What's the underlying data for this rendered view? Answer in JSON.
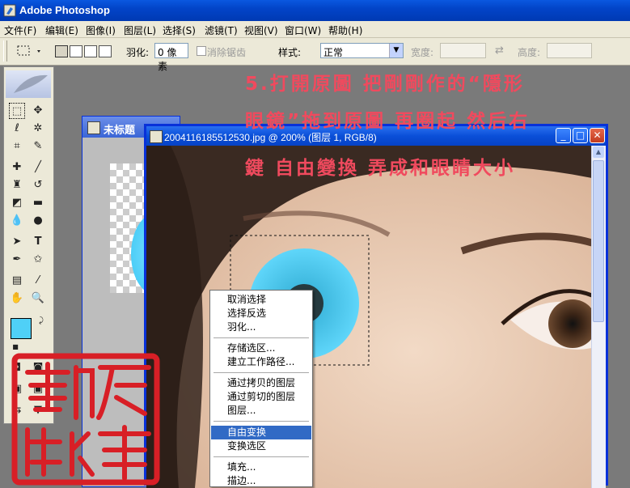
{
  "app": {
    "title": "Adobe Photoshop"
  },
  "menubar": {
    "items": [
      "文件(F)",
      "编辑(E)",
      "图像(I)",
      "图层(L)",
      "选择(S)",
      "滤镜(T)",
      "视图(V)",
      "窗口(W)",
      "帮助(H)"
    ]
  },
  "options": {
    "feather_label": "羽化:",
    "feather_value": "0 像素",
    "antialias_label": "消除锯齿",
    "style_label": "样式:",
    "style_value": "正常",
    "width_label": "宽度:",
    "height_label": "高度:"
  },
  "doc_back": {
    "title": "未标题"
  },
  "doc_front": {
    "title": "2004116185512530.jpg @ 200% (图层 1, RGB/8)"
  },
  "colors": {
    "foreground": "#4fd0f7",
    "background": "#ffffff",
    "annotation": "#f04a5e",
    "menu_highlight": "#316ac5"
  },
  "annotation": {
    "line1": "5.打開原圖 把剛剛作的“隱形",
    "line2": "眼鏡”拖到原圖 再圈起 然后右",
    "line3": "鍵 自由變換 弄成和眼睛大小"
  },
  "context_menu": {
    "items": [
      "取消选择",
      "选择反选",
      "羽化...",
      "存储选区...",
      "建立工作路径...",
      "通过拷贝的图层",
      "通过剪切的图层",
      "图层...",
      "自由变换",
      "变换选区",
      "填充...",
      "描边..."
    ],
    "selected": "自由变换"
  },
  "seal": {
    "text": "彭虎軒 作"
  },
  "icons": [
    "photoshop-logo-icon",
    "marquee-icon",
    "move-icon",
    "lasso-icon",
    "magic-wand-icon",
    "crop-icon",
    "slice-icon",
    "healing-brush-icon",
    "brush-icon",
    "clone-stamp-icon",
    "history-brush-icon",
    "eraser-icon",
    "gradient-icon",
    "blur-icon",
    "dodge-icon",
    "path-selection-icon",
    "type-icon",
    "pen-icon",
    "shape-icon",
    "notes-icon",
    "eyedropper-icon",
    "hand-icon",
    "zoom-icon",
    "swap-colors-icon",
    "minimize-icon",
    "maximize-icon",
    "close-icon"
  ]
}
